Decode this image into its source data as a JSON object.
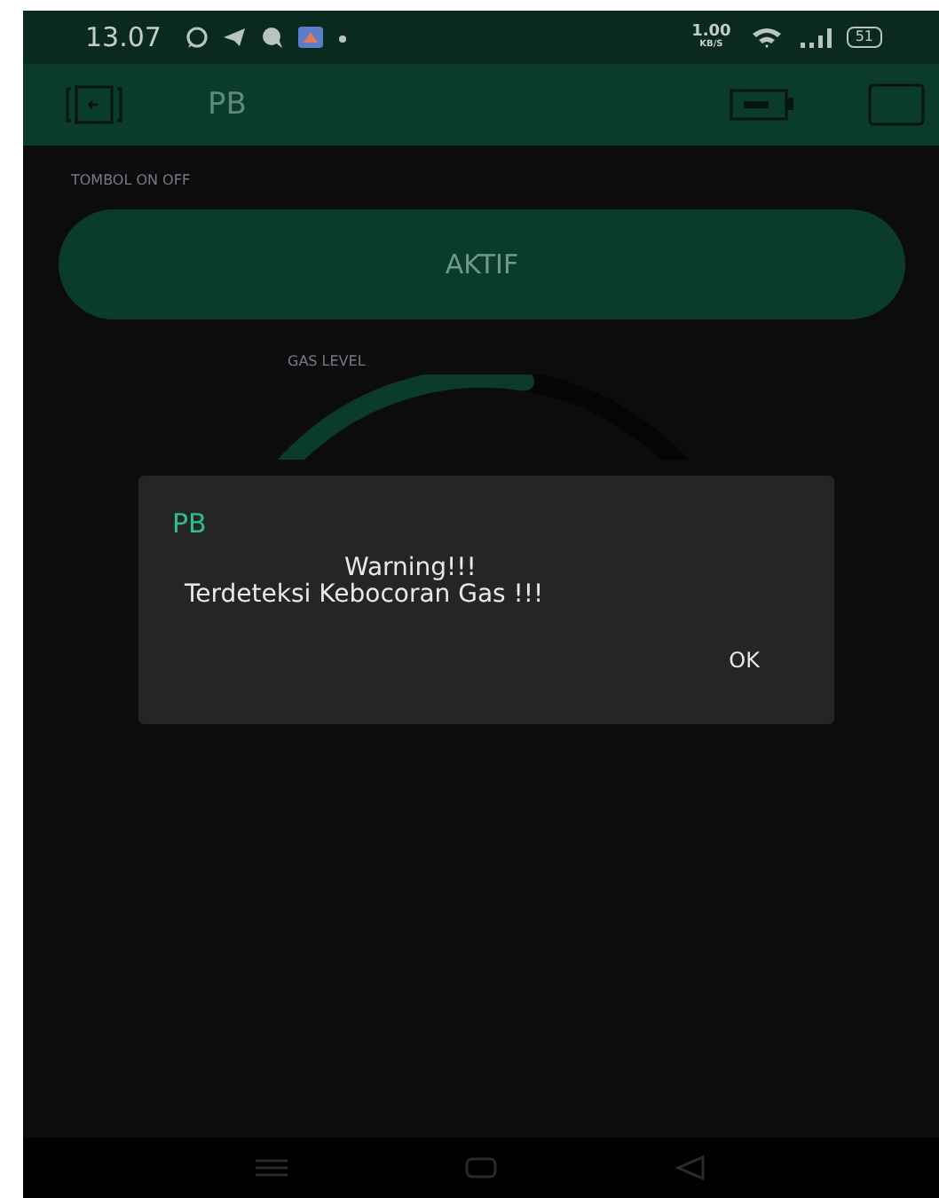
{
  "status_bar": {
    "time": "13.07",
    "speed": "1.00",
    "speed_unit": "KB/S",
    "battery": "51"
  },
  "app_bar": {
    "title": "PB"
  },
  "switch": {
    "label": "TOMBOL ON OFF",
    "button": "AKTIF",
    "on": true
  },
  "gauge": {
    "label": "GAS LEVEL",
    "level": 0.55
  },
  "dialog": {
    "title": "PB",
    "message": [
      "Warning!!!",
      "Terdeteksi Kebocoran Gas !!!"
    ],
    "button": "OK"
  }
}
